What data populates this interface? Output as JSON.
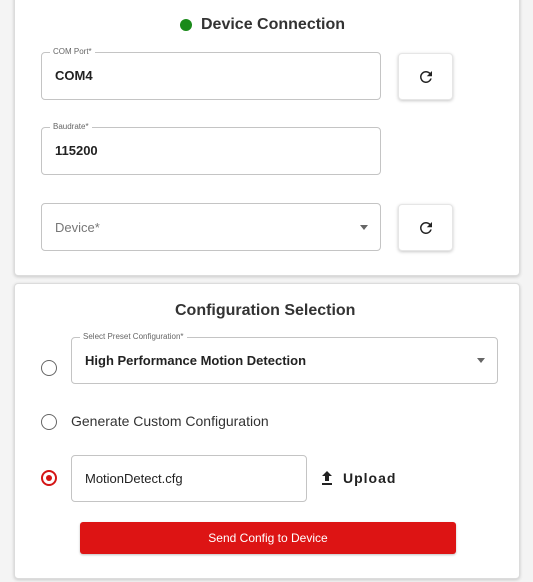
{
  "device_connection": {
    "title": "Device Connection",
    "status_color": "#1a8a1a",
    "com_port": {
      "label": "COM Port*",
      "value": "COM4"
    },
    "baudrate": {
      "label": "Baudrate*",
      "value": "115200"
    },
    "device": {
      "placeholder": "Device*"
    },
    "refresh_icon": "refresh-icon"
  },
  "configuration": {
    "title": "Configuration Selection",
    "preset": {
      "label": "Select Preset Configuration*",
      "value": "High Performance Motion Detection",
      "selected": false
    },
    "custom": {
      "label": "Generate Custom Configuration",
      "selected": false
    },
    "file": {
      "value": "MotionDetect.cfg",
      "selected": true
    },
    "upload_label": "Upload",
    "send_label": "Send Config to Device",
    "accent_color": "#dd1414"
  }
}
